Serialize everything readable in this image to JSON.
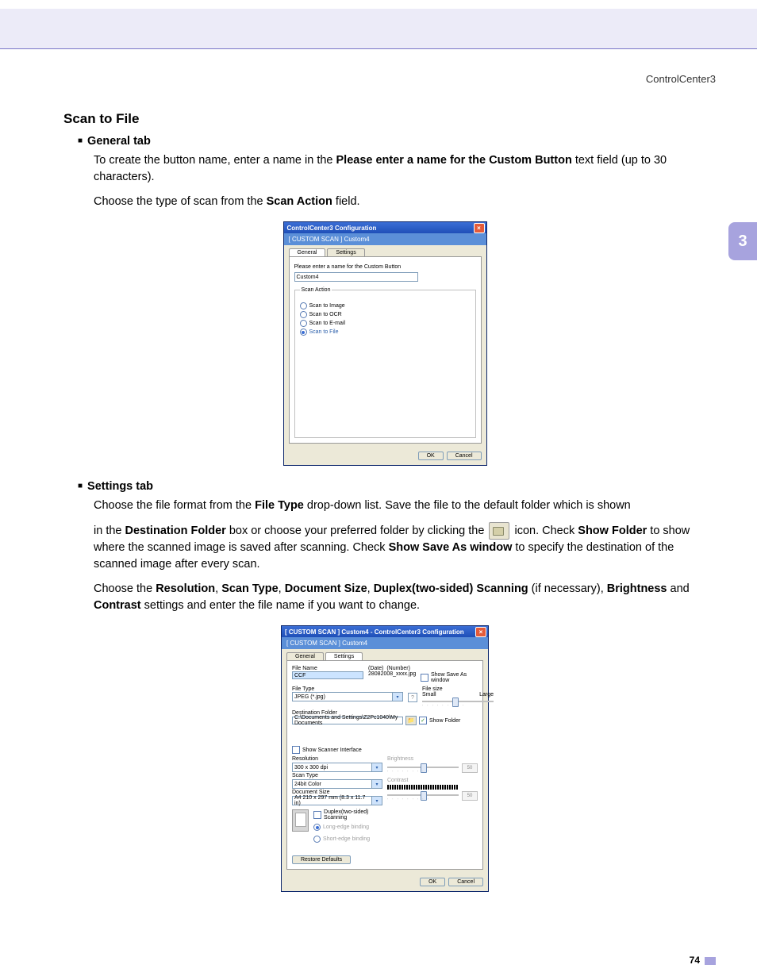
{
  "header": {
    "breadcrumb": "ControlCenter3"
  },
  "side_tab": "3",
  "footer": {
    "page_num": "74"
  },
  "section": {
    "title": "Scan to File",
    "general_tab": "General tab",
    "p1_a": "To create the button name, enter a name in the ",
    "p1_bold": "Please enter a name for the Custom Button",
    "p1_b": " text field (up to 30 characters).",
    "p2_a": "Choose the type of scan from the ",
    "p2_bold": "Scan Action",
    "p2_b": " field.",
    "settings_tab": "Settings tab",
    "p3_a": "Choose the file format from the ",
    "p3_bold": "File Type",
    "p3_b": " drop-down list. Save the file to the default folder which is shown",
    "p4_a": "in the ",
    "p4_bold1": "Destination Folder",
    "p4_b": " box or choose your preferred folder by clicking the ",
    "p4_c": " icon. Check ",
    "p4_bold2": "Show Folder",
    "p4_d": " to show where the scanned image is saved after scanning. Check ",
    "p4_bold3": "Show Save As window",
    "p4_e": " to specify the destination of the scanned image after every scan.",
    "p5_a": "Choose the ",
    "p5_b1": "Resolution",
    "p5_c1": ", ",
    "p5_b2": "Scan Type",
    "p5_c2": ", ",
    "p5_b3": "Document Size",
    "p5_c3": ", ",
    "p5_b4": "Duplex(two-sided) Scanning",
    "p5_c4": " (if necessary), ",
    "p5_b5": "Brightness",
    "p5_c5": " and ",
    "p5_b6": "Contrast",
    "p5_c6": " settings and enter the file name if you want to change."
  },
  "dialog1": {
    "title": "ControlCenter3 Configuration",
    "subheader": "[ CUSTOM SCAN ]   Custom4",
    "tabs": {
      "general": "General",
      "settings": "Settings"
    },
    "prompt": "Please enter a name for the Custom Button",
    "name_value": "Custom4",
    "scan_action_legend": "Scan Action",
    "actions": {
      "image": "Scan to Image",
      "ocr": "Scan to OCR",
      "email": "Scan to E-mail",
      "file": "Scan to File"
    },
    "ok": "OK",
    "cancel": "Cancel"
  },
  "dialog2": {
    "title": "[ CUSTOM SCAN ]  Custom4 - ControlCenter3 Configuration",
    "subheader": "[ CUSTOM SCAN ]   Custom4",
    "tabs": {
      "general": "General",
      "settings": "Settings"
    },
    "file_name_label": "File Name",
    "file_name_value": "CCF",
    "date_label": "(Date)",
    "number_label": "(Number)",
    "date_value": "28082008_xxxx.jpg",
    "show_save_as": "Show Save As window",
    "file_type_label": "File Type",
    "file_type_value": "JPEG (*.jpg)",
    "file_size_label": "File size",
    "file_size_small": "Small",
    "file_size_large": "Large",
    "dest_folder_label": "Destination Folder",
    "dest_folder_value": "C:\\Documents and Settings\\Z2Pc1040\\My Documents",
    "show_folder": "Show Folder",
    "show_scanner_interface": "Show Scanner Interface",
    "resolution_label": "Resolution",
    "resolution_value": "300 x 300 dpi",
    "scan_type_label": "Scan Type",
    "scan_type_value": "24bit Color",
    "doc_size_label": "Document Size",
    "doc_size_value": "A4 210 x 297 mm (8.3 x 11.7 in)",
    "brightness_label": "Brightness",
    "brightness_value": "50",
    "contrast_label": "Contrast",
    "contrast_value": "50",
    "duplex_label": "Duplex(two-sided) Scanning",
    "long_edge": "Long-edge binding",
    "short_edge": "Short-edge binding",
    "restore": "Restore Defaults",
    "ok": "OK",
    "cancel": "Cancel"
  }
}
